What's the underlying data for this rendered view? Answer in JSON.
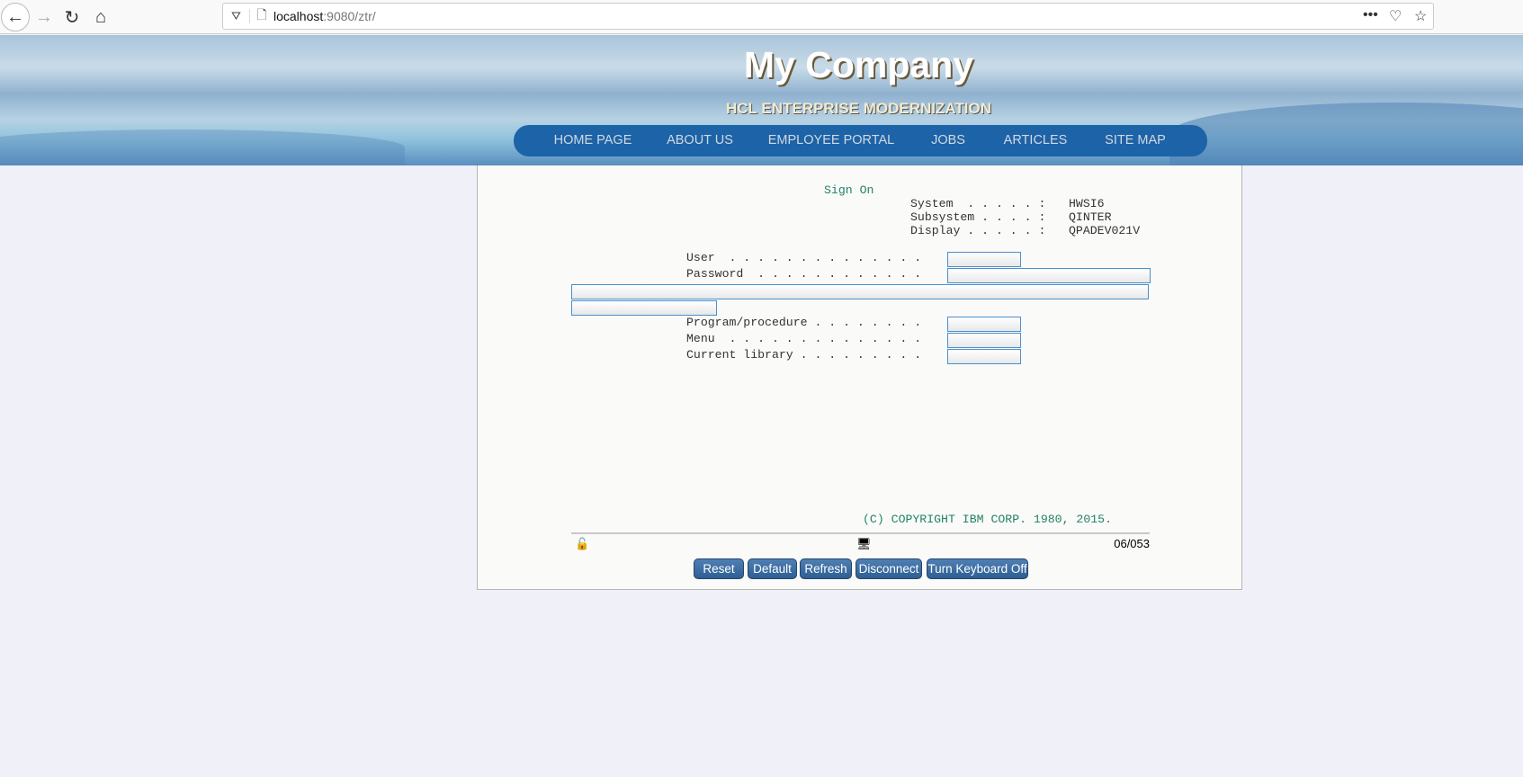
{
  "browser": {
    "url_host": "localhost",
    "url_rest": ":9080/ztr/"
  },
  "header": {
    "title": "My Company",
    "subtitle": "HCL ENTERPRISE MODERNIZATION",
    "nav": [
      "HOME PAGE",
      "ABOUT US",
      "EMPLOYEE PORTAL",
      "JOBS",
      "ARTICLES",
      "SITE MAP"
    ]
  },
  "screen": {
    "title": "Sign On",
    "info": [
      {
        "label": "System  . . . . . :",
        "value": "HWSI6"
      },
      {
        "label": "Subsystem . . . . :",
        "value": "QINTER"
      },
      {
        "label": "Display . . . . . :",
        "value": "QPADEV021V"
      }
    ],
    "fields": [
      {
        "label": "User  . . . . . . . . . . . . . .",
        "value": ""
      },
      {
        "label": "Password  . . . . . . . . . . . .",
        "value": ""
      },
      {
        "label": "Program/procedure . . . . . . . .",
        "value": ""
      },
      {
        "label": "Menu  . . . . . . . . . . . . . .",
        "value": ""
      },
      {
        "label": "Current library . . . . . . . . .",
        "value": ""
      }
    ],
    "copyright": "(C) COPYRIGHT IBM CORP. 1980, 2015."
  },
  "status": {
    "cursor": "06/053"
  },
  "buttons": [
    "Reset",
    "Default",
    "Refresh",
    "Disconnect",
    "Turn Keyboard Off"
  ]
}
